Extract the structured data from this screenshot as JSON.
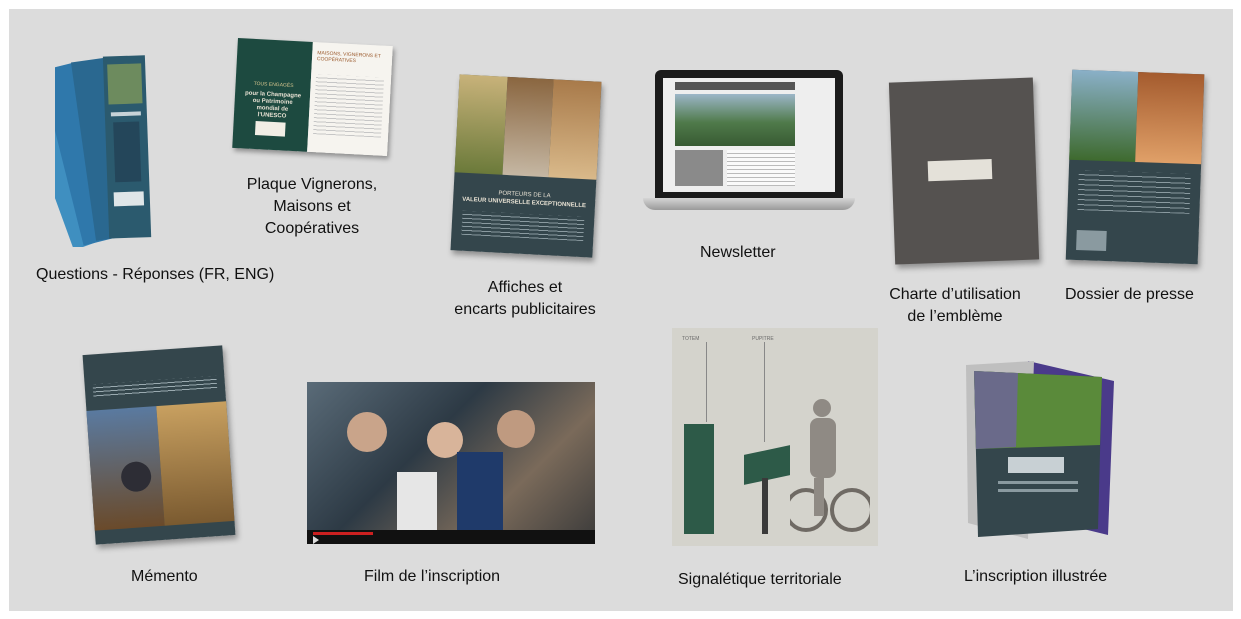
{
  "items": [
    {
      "caption": "Questions - Réponses (FR, ENG)"
    },
    {
      "caption_lines": [
        "Plaque Vignerons,",
        "Maisons et",
        "Coopératives"
      ],
      "plaque": {
        "left_title": "TOUS ENGAGÉS",
        "left_text": "pour la Champagne ou Patrimoine mondial de l'UNESCO",
        "right_title": "MAISONS, VIGNERONS ET COOPÉRATIVES"
      }
    },
    {
      "caption_lines": [
        "Affiches et",
        "encarts publicitaires"
      ],
      "poster": {
        "title1": "PORTEURS DE LA",
        "title2": "VALEUR UNIVERSELLE EXCEPTIONNELLE"
      }
    },
    {
      "caption": "Newsletter"
    },
    {
      "caption_lines": [
        "Charte d’utilisation",
        "de l’emblème"
      ]
    },
    {
      "caption": "Dossier de presse"
    },
    {
      "caption": "Mémento"
    },
    {
      "caption": "Film de l’inscription"
    },
    {
      "caption": "Signalétique territoriale",
      "sign": {
        "label_left": "TOTEM",
        "label_right": "PUPITRE"
      }
    },
    {
      "caption": "L’inscription illustrée"
    }
  ]
}
